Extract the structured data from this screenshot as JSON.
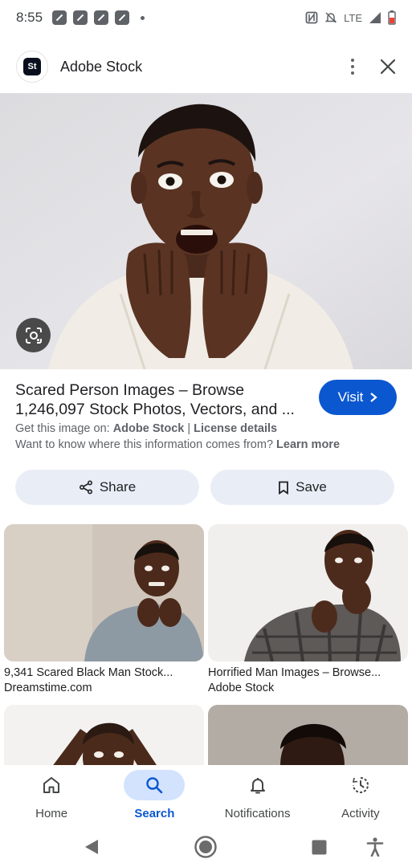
{
  "status_bar": {
    "time": "8:55",
    "network": "LTE",
    "notification_icons": [
      "news-icon",
      "news-icon",
      "news-icon",
      "news-icon"
    ]
  },
  "header": {
    "logo_text": "St",
    "title": "Adobe Stock"
  },
  "result": {
    "title_line1": "Scared Person Images – Browse",
    "title_line2": "1,246,097 Stock Photos, Vectors, and ...",
    "source_prefix": "Get this image on: ",
    "source_name": "Adobe Stock",
    "source_separator": " | ",
    "license": "License details",
    "note_text": "Want to know where this information comes from? ",
    "note_link": "Learn more",
    "visit_label": "Visit"
  },
  "actions": {
    "share_label": "Share",
    "save_label": "Save"
  },
  "related": [
    {
      "title": "9,341 Scared Black Man Stock...",
      "source": "Dreamstime.com"
    },
    {
      "title": "Horrified Man Images – Browse...",
      "source": "Adobe Stock"
    }
  ],
  "bottom_nav": [
    {
      "label": "Home",
      "icon": "home-icon",
      "active": false
    },
    {
      "label": "Search",
      "icon": "search-icon",
      "active": true
    },
    {
      "label": "Notifications",
      "icon": "bell-icon",
      "active": false
    },
    {
      "label": "Activity",
      "icon": "activity-icon",
      "active": false
    }
  ],
  "colors": {
    "accent": "#0b57d0",
    "accent_light": "#d3e3fd",
    "chip_bg": "#e9eef6"
  }
}
